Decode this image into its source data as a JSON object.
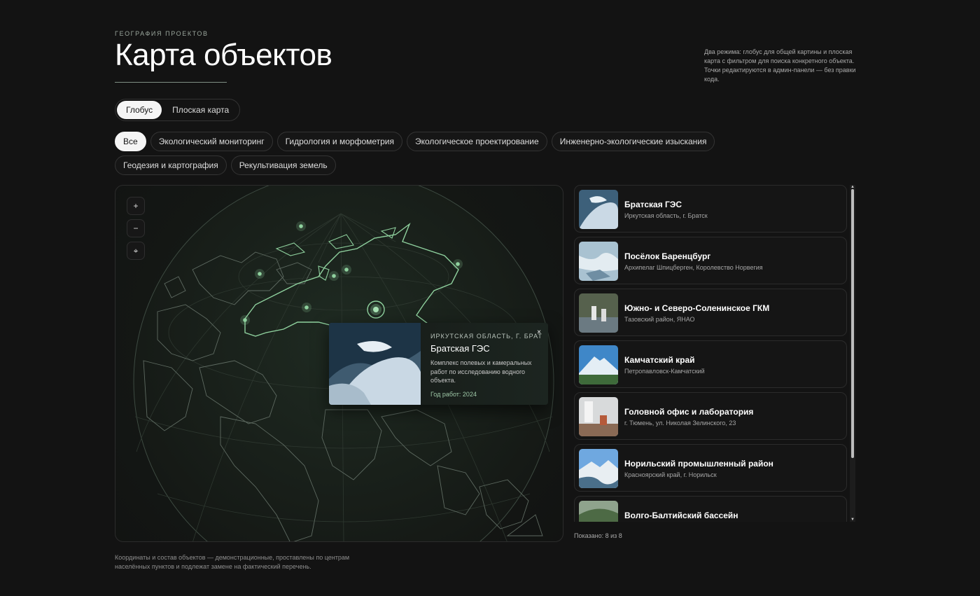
{
  "header": {
    "eyebrow": "ГЕОГРАФИЯ ПРОЕКТОВ",
    "title": "Карта объектов",
    "intro": "Два режима: глобус для общей картины и плоская карта с фильтром для поиска конкретного объекта. Точки редактируются в админ-панели — без правки кода."
  },
  "modes": [
    {
      "label": "Глобус",
      "active": true
    },
    {
      "label": "Плоская карта",
      "active": false
    }
  ],
  "filters": [
    {
      "label": "Все",
      "active": true
    },
    {
      "label": "Экологический мониторинг",
      "active": false
    },
    {
      "label": "Гидрология и морфометрия",
      "active": false
    },
    {
      "label": "Экологическое проектирование",
      "active": false
    },
    {
      "label": "Инженерно-экологические изыскания",
      "active": false
    },
    {
      "label": "Геодезия и картография",
      "active": false
    },
    {
      "label": "Рекультивация земель",
      "active": false
    }
  ],
  "map": {
    "controls": {
      "zoom_in": "+",
      "zoom_out": "−",
      "locate": "⌖"
    },
    "popup": {
      "region": "ИРКУТСКАЯ ОБЛАСТЬ, Г. БРАТСК",
      "title": "Братская ГЭС",
      "description": "Комплекс полевых и камеральных работ по исследованию водного объекта.",
      "year": "Год работ: 2024",
      "close": "×"
    }
  },
  "objects": [
    {
      "title": "Братская ГЭС",
      "subtitle": "Иркутская область, г. Братск"
    },
    {
      "title": "Посёлок Баренцбург",
      "subtitle": "Архипелаг Шпицберген, Королевство Норвегия"
    },
    {
      "title": "Южно- и Северо-Соленинское ГКМ",
      "subtitle": "Тазовский район, ЯНАО"
    },
    {
      "title": "Камчатский край",
      "subtitle": "Петропавловск-Камчатский"
    },
    {
      "title": "Головной офис и лаборатория",
      "subtitle": "г. Тюмень, ул. Николая Зелинского, 23"
    },
    {
      "title": "Норильский промышленный район",
      "subtitle": "Красноярский край, г. Норильск"
    },
    {
      "title": "Волго-Балтийский бассейн",
      "subtitle": ""
    }
  ],
  "list_footer": {
    "shown": "Показано: 8 из 8",
    "scroll_up": "▲",
    "scroll_down": "▼"
  },
  "footnote": "Координаты и состав объектов — демонстрационные, проставлены по центрам населённых пунктов и подлежат замене на фактический перечень.",
  "colors": {
    "accent": "#8fd19e",
    "background": "#131313",
    "card_border": "#2b2b2b"
  }
}
